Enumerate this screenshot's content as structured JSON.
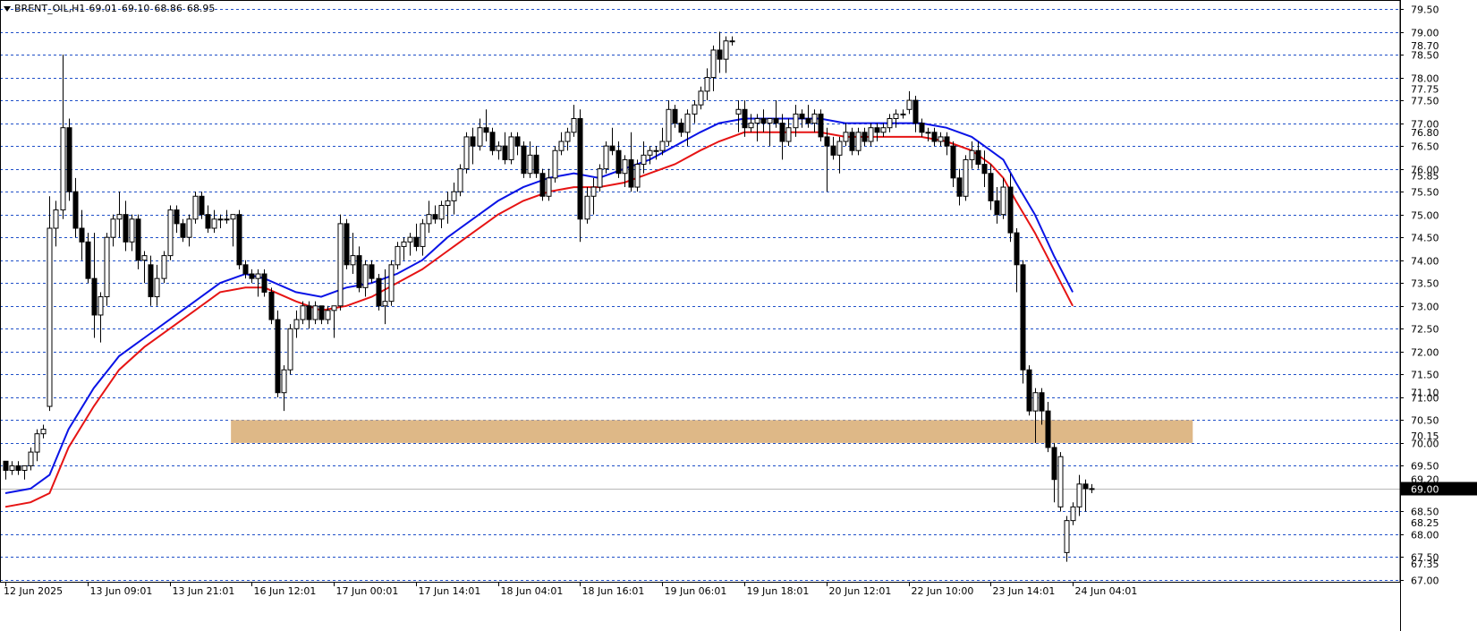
{
  "header": {
    "symbol": "BRENT_OIL,H1",
    "open": "69.01",
    "high": "69.10",
    "low": "68.86",
    "close": "68.95"
  },
  "colors": {
    "background": "#ffffff",
    "grid": "#1f4fc8",
    "bull_body": "#ffffff",
    "bear_body": "#000000",
    "candle_outline": "#000000",
    "ma_fast": "#0a14e6",
    "ma_slow": "#e61414",
    "support_zone": "#deb887",
    "current_price_label_bg": "#000000"
  },
  "chart_data": {
    "type": "candlestick",
    "symbol": "BRENT_OIL",
    "timeframe": "H1",
    "ylim": [
      67.0,
      79.5
    ],
    "y_ticks": [
      79.5,
      79.0,
      78.5,
      78.0,
      77.5,
      77.0,
      76.5,
      76.0,
      75.5,
      75.0,
      74.5,
      74.0,
      73.5,
      73.0,
      72.5,
      72.0,
      71.5,
      71.0,
      70.5,
      70.0,
      69.5,
      69.0,
      68.5,
      68.0,
      67.5,
      67.0
    ],
    "y_tick_labels": [
      "79.50",
      "79.00",
      "78.50",
      "78.00",
      "77.50",
      "77.00",
      "76.50",
      "76.00",
      "75.50",
      "75.00",
      "74.50",
      "74.00",
      "73.50",
      "73.00",
      "72.50",
      "72.00",
      "71.50",
      "71.00",
      "70.50",
      "70.00",
      "69.50",
      "69.00",
      "68.50",
      "68.00",
      "67.50",
      "67.00"
    ],
    "extra_price_labels": [
      {
        "value": 78.7,
        "label": "78.70"
      },
      {
        "value": 77.75,
        "label": "77.75"
      },
      {
        "value": 76.8,
        "label": "76.80"
      },
      {
        "value": 75.85,
        "label": "75.85"
      },
      {
        "value": 71.1,
        "label": "71.10"
      },
      {
        "value": 70.15,
        "label": "70.15"
      },
      {
        "value": 69.2,
        "label": "69.20"
      },
      {
        "value": 68.25,
        "label": "68.25"
      },
      {
        "value": 67.35,
        "label": "67.35"
      }
    ],
    "current_price": {
      "value": 69.0,
      "label": "69.00"
    },
    "x_tick_labels": [
      "12 Jun 2025",
      "13 Jun 09:01",
      "13 Jun 21:01",
      "16 Jun 12:01",
      "17 Jun 00:01",
      "17 Jun 14:01",
      "18 Jun 04:01",
      "18 Jun 16:01",
      "19 Jun 06:01",
      "19 Jun 18:01",
      "20 Jun 12:01",
      "22 Jun 10:00",
      "23 Jun 14:01",
      "24 Jun 04:01"
    ],
    "x_tick_positions": [
      0,
      13,
      26,
      39,
      52,
      65,
      78,
      91,
      104,
      117,
      130,
      143,
      156,
      169
    ],
    "support_zone": {
      "from": 70.0,
      "to": 70.5,
      "start_index": 36,
      "end_index": 188
    },
    "candles": [
      [
        69.6,
        69.6,
        69.2,
        69.4
      ],
      [
        69.4,
        69.6,
        69.3,
        69.5
      ],
      [
        69.5,
        69.6,
        69.3,
        69.4
      ],
      [
        69.4,
        69.5,
        69.2,
        69.5
      ],
      [
        69.5,
        69.9,
        69.4,
        69.8
      ],
      [
        69.8,
        70.3,
        69.6,
        70.2
      ],
      [
        70.2,
        70.4,
        70.1,
        70.3
      ],
      [
        70.8,
        75.4,
        70.7,
        74.7
      ],
      [
        74.7,
        75.3,
        74.3,
        75.1
      ],
      [
        75.1,
        78.5,
        74.9,
        76.9
      ],
      [
        76.9,
        77.1,
        75.3,
        75.5
      ],
      [
        75.5,
        75.8,
        74.5,
        74.7
      ],
      [
        74.7,
        75.1,
        74.0,
        74.4
      ],
      [
        74.4,
        74.6,
        73.5,
        73.6
      ],
      [
        73.6,
        74.6,
        72.3,
        72.8
      ],
      [
        72.8,
        73.3,
        72.2,
        73.2
      ],
      [
        73.2,
        74.6,
        73.0,
        74.5
      ],
      [
        74.5,
        75.0,
        74.3,
        74.9
      ],
      [
        74.9,
        75.5,
        74.5,
        75.0
      ],
      [
        75.0,
        75.3,
        74.2,
        74.4
      ],
      [
        74.4,
        75.0,
        74.2,
        74.9
      ],
      [
        74.9,
        75.0,
        73.8,
        74.0
      ],
      [
        74.0,
        74.2,
        73.5,
        74.1
      ],
      [
        73.9,
        74.1,
        73.0,
        73.2
      ],
      [
        73.2,
        73.9,
        73.0,
        73.6
      ],
      [
        73.6,
        74.2,
        73.5,
        74.1
      ],
      [
        74.1,
        75.2,
        74.0,
        75.1
      ],
      [
        75.1,
        75.2,
        74.6,
        74.8
      ],
      [
        74.8,
        74.9,
        74.4,
        74.5
      ],
      [
        74.5,
        75.0,
        74.3,
        74.9
      ],
      [
        74.9,
        75.5,
        74.8,
        75.4
      ],
      [
        75.4,
        75.5,
        74.9,
        75.0
      ],
      [
        75.0,
        75.2,
        74.6,
        74.7
      ],
      [
        74.7,
        75.1,
        74.6,
        74.9
      ],
      [
        74.9,
        75.0,
        74.7,
        74.9
      ],
      [
        74.9,
        75.1,
        74.8,
        74.9
      ],
      [
        74.9,
        75.0,
        74.3,
        75.0
      ],
      [
        75.0,
        75.1,
        73.8,
        73.9
      ],
      [
        73.9,
        74.0,
        73.6,
        73.7
      ],
      [
        73.7,
        73.8,
        73.5,
        73.6
      ],
      [
        73.6,
        73.8,
        73.2,
        73.7
      ],
      [
        73.7,
        73.8,
        73.2,
        73.3
      ],
      [
        73.3,
        73.4,
        72.6,
        72.7
      ],
      [
        72.7,
        72.9,
        71.0,
        71.1
      ],
      [
        71.1,
        71.7,
        70.7,
        71.6
      ],
      [
        71.6,
        72.6,
        71.5,
        72.5
      ],
      [
        72.5,
        72.9,
        72.3,
        72.7
      ],
      [
        72.7,
        73.1,
        72.6,
        73.0
      ],
      [
        73.0,
        73.1,
        72.5,
        72.7
      ],
      [
        72.7,
        73.1,
        72.6,
        73.0
      ],
      [
        73.0,
        73.0,
        72.6,
        72.7
      ],
      [
        72.7,
        73.0,
        72.6,
        72.9
      ],
      [
        72.9,
        73.0,
        72.3,
        73.0
      ],
      [
        73.0,
        75.0,
        72.9,
        74.8
      ],
      [
        74.8,
        74.9,
        73.8,
        73.9
      ],
      [
        73.9,
        74.6,
        73.7,
        74.1
      ],
      [
        74.1,
        74.3,
        73.3,
        73.4
      ],
      [
        73.4,
        74.0,
        73.2,
        73.9
      ],
      [
        73.9,
        74.0,
        73.5,
        73.6
      ],
      [
        73.6,
        73.7,
        72.9,
        73.0
      ],
      [
        73.0,
        73.8,
        72.6,
        73.1
      ],
      [
        73.1,
        74.0,
        73.0,
        73.9
      ],
      [
        73.9,
        74.4,
        73.8,
        74.3
      ],
      [
        74.3,
        74.5,
        74.0,
        74.4
      ],
      [
        74.4,
        74.6,
        74.1,
        74.5
      ],
      [
        74.5,
        74.8,
        74.2,
        74.3
      ],
      [
        74.3,
        74.9,
        74.1,
        74.8
      ],
      [
        74.8,
        75.3,
        74.6,
        75.0
      ],
      [
        75.0,
        75.2,
        74.8,
        74.9
      ],
      [
        74.9,
        75.3,
        74.7,
        75.2
      ],
      [
        75.2,
        75.5,
        74.8,
        75.3
      ],
      [
        75.3,
        75.7,
        75.0,
        75.5
      ],
      [
        75.5,
        76.1,
        75.4,
        76.0
      ],
      [
        76.0,
        76.8,
        75.9,
        76.7
      ],
      [
        76.7,
        76.9,
        76.1,
        76.5
      ],
      [
        76.5,
        77.1,
        76.4,
        76.9
      ],
      [
        76.9,
        77.3,
        76.6,
        76.8
      ],
      [
        76.8,
        76.9,
        76.3,
        76.4
      ],
      [
        76.4,
        76.6,
        76.2,
        76.5
      ],
      [
        76.5,
        76.8,
        76.1,
        76.2
      ],
      [
        76.2,
        76.8,
        76.1,
        76.7
      ],
      [
        76.7,
        76.8,
        76.3,
        76.5
      ],
      [
        76.5,
        76.6,
        75.8,
        75.9
      ],
      [
        75.9,
        76.6,
        75.8,
        76.3
      ],
      [
        76.3,
        76.5,
        75.8,
        75.9
      ],
      [
        75.9,
        76.0,
        75.3,
        75.4
      ],
      [
        75.4,
        76.0,
        75.3,
        75.8
      ],
      [
        75.8,
        76.5,
        75.7,
        76.4
      ],
      [
        76.4,
        76.8,
        76.3,
        76.6
      ],
      [
        76.6,
        76.9,
        76.4,
        76.8
      ],
      [
        76.8,
        77.4,
        76.7,
        77.1
      ],
      [
        77.1,
        77.3,
        74.4,
        74.9
      ],
      [
        74.9,
        75.6,
        74.8,
        75.4
      ],
      [
        75.4,
        75.8,
        75.0,
        75.6
      ],
      [
        75.6,
        76.1,
        75.5,
        76.0
      ],
      [
        76.0,
        76.6,
        75.9,
        76.5
      ],
      [
        76.5,
        76.9,
        76.3,
        76.4
      ],
      [
        76.4,
        76.6,
        75.8,
        75.9
      ],
      [
        75.9,
        76.3,
        75.6,
        76.2
      ],
      [
        76.2,
        76.8,
        75.5,
        75.6
      ],
      [
        75.6,
        76.2,
        75.5,
        76.1
      ],
      [
        76.1,
        76.6,
        75.9,
        76.3
      ],
      [
        76.3,
        76.5,
        76.1,
        76.4
      ],
      [
        76.4,
        76.5,
        76.2,
        76.4
      ],
      [
        76.4,
        76.9,
        76.3,
        76.6
      ],
      [
        76.6,
        77.5,
        76.5,
        77.3
      ],
      [
        77.3,
        77.4,
        76.9,
        77.0
      ],
      [
        77.0,
        77.1,
        76.7,
        76.8
      ],
      [
        76.8,
        77.3,
        76.5,
        77.2
      ],
      [
        77.2,
        77.5,
        77.0,
        77.4
      ],
      [
        77.4,
        77.8,
        77.3,
        77.7
      ],
      [
        77.7,
        78.2,
        77.5,
        78.0
      ],
      [
        78.0,
        78.7,
        77.7,
        78.6
      ],
      [
        78.6,
        79.0,
        78.1,
        78.4
      ],
      [
        78.4,
        78.9,
        78.1,
        78.8
      ],
      [
        78.8,
        78.9,
        78.7,
        78.8
      ],
      [
        77.2,
        77.5,
        76.8,
        77.3
      ],
      [
        77.3,
        77.5,
        76.7,
        76.9
      ],
      [
        76.9,
        77.2,
        76.8,
        77.0
      ],
      [
        77.0,
        77.2,
        76.6,
        77.1
      ],
      [
        77.1,
        77.3,
        76.8,
        77.0
      ],
      [
        77.0,
        77.1,
        76.5,
        77.1
      ],
      [
        77.1,
        77.5,
        76.9,
        77.0
      ],
      [
        77.0,
        77.2,
        76.2,
        76.6
      ],
      [
        76.6,
        77.1,
        76.5,
        76.9
      ],
      [
        76.9,
        77.4,
        76.7,
        77.2
      ],
      [
        77.2,
        77.3,
        76.9,
        77.1
      ],
      [
        77.1,
        77.4,
        76.9,
        77.0
      ],
      [
        77.0,
        77.3,
        76.8,
        77.2
      ],
      [
        77.2,
        77.3,
        76.6,
        76.7
      ],
      [
        76.7,
        76.9,
        75.5,
        76.5
      ],
      [
        76.5,
        76.7,
        76.2,
        76.3
      ],
      [
        76.3,
        76.7,
        75.9,
        76.6
      ],
      [
        76.6,
        77.0,
        76.5,
        76.8
      ],
      [
        76.8,
        76.9,
        76.3,
        76.4
      ],
      [
        76.4,
        76.9,
        76.3,
        76.8
      ],
      [
        76.8,
        76.9,
        76.5,
        76.6
      ],
      [
        76.6,
        77.0,
        76.5,
        76.9
      ],
      [
        76.9,
        77.0,
        76.6,
        76.8
      ],
      [
        76.8,
        77.0,
        76.7,
        76.9
      ],
      [
        76.9,
        77.2,
        76.8,
        77.1
      ],
      [
        77.1,
        77.3,
        76.9,
        77.2
      ],
      [
        77.2,
        77.3,
        77.1,
        77.2
      ],
      [
        77.3,
        77.7,
        77.2,
        77.5
      ],
      [
        77.5,
        77.6,
        76.8,
        77.0
      ],
      [
        77.0,
        77.1,
        76.7,
        76.8
      ],
      [
        76.8,
        76.9,
        76.6,
        76.8
      ],
      [
        76.8,
        76.9,
        76.5,
        76.6
      ],
      [
        76.6,
        76.8,
        76.5,
        76.7
      ],
      [
        76.7,
        76.8,
        76.3,
        76.5
      ],
      [
        76.5,
        76.6,
        75.6,
        75.8
      ],
      [
        75.8,
        76.0,
        75.2,
        75.4
      ],
      [
        75.4,
        76.3,
        75.3,
        76.2
      ],
      [
        76.2,
        76.6,
        76.0,
        76.4
      ],
      [
        76.4,
        76.6,
        76.0,
        76.1
      ],
      [
        76.1,
        76.4,
        75.6,
        75.9
      ],
      [
        75.9,
        76.1,
        75.1,
        75.3
      ],
      [
        75.3,
        75.6,
        74.8,
        75.0
      ],
      [
        75.0,
        75.8,
        74.9,
        75.6
      ],
      [
        75.6,
        75.9,
        74.4,
        74.6
      ],
      [
        74.6,
        74.7,
        73.3,
        73.9
      ],
      [
        73.9,
        74.0,
        71.3,
        71.6
      ],
      [
        71.6,
        71.7,
        70.6,
        70.7
      ],
      [
        70.7,
        71.2,
        70.0,
        71.1
      ],
      [
        71.1,
        71.2,
        70.4,
        70.7
      ],
      [
        70.7,
        70.9,
        69.8,
        69.9
      ],
      [
        69.9,
        70.0,
        68.7,
        69.2
      ],
      [
        68.6,
        69.8,
        68.5,
        69.7
      ],
      [
        67.6,
        68.4,
        67.4,
        68.3
      ],
      [
        68.3,
        68.7,
        68.2,
        68.6
      ],
      [
        68.6,
        69.3,
        68.4,
        69.1
      ],
      [
        69.1,
        69.2,
        68.5,
        69.0
      ],
      [
        69.0,
        69.1,
        68.9,
        69.0
      ]
    ],
    "ma_fast": [
      [
        0,
        68.9
      ],
      [
        4,
        69.0
      ],
      [
        7,
        69.3
      ],
      [
        10,
        70.3
      ],
      [
        14,
        71.2
      ],
      [
        18,
        71.9
      ],
      [
        22,
        72.3
      ],
      [
        26,
        72.7
      ],
      [
        30,
        73.1
      ],
      [
        34,
        73.5
      ],
      [
        38,
        73.7
      ],
      [
        41,
        73.6
      ],
      [
        46,
        73.3
      ],
      [
        50,
        73.2
      ],
      [
        54,
        73.4
      ],
      [
        58,
        73.5
      ],
      [
        62,
        73.7
      ],
      [
        66,
        74.0
      ],
      [
        70,
        74.5
      ],
      [
        74,
        74.9
      ],
      [
        78,
        75.3
      ],
      [
        82,
        75.6
      ],
      [
        86,
        75.8
      ],
      [
        90,
        75.9
      ],
      [
        94,
        75.8
      ],
      [
        98,
        76.0
      ],
      [
        102,
        76.2
      ],
      [
        106,
        76.5
      ],
      [
        110,
        76.8
      ],
      [
        113,
        77.0
      ],
      [
        117,
        77.1
      ],
      [
        121,
        77.1
      ],
      [
        125,
        77.1
      ],
      [
        129,
        77.1
      ],
      [
        133,
        77.0
      ],
      [
        137,
        77.0
      ],
      [
        141,
        77.0
      ],
      [
        145,
        77.0
      ],
      [
        149,
        76.9
      ],
      [
        153,
        76.7
      ],
      [
        156,
        76.4
      ],
      [
        158,
        76.2
      ],
      [
        160,
        75.7
      ],
      [
        163,
        75.0
      ],
      [
        166,
        74.1
      ],
      [
        169,
        73.3
      ]
    ],
    "ma_slow": [
      [
        0,
        68.6
      ],
      [
        4,
        68.7
      ],
      [
        7,
        68.9
      ],
      [
        10,
        69.9
      ],
      [
        14,
        70.8
      ],
      [
        18,
        71.6
      ],
      [
        22,
        72.1
      ],
      [
        26,
        72.5
      ],
      [
        30,
        72.9
      ],
      [
        34,
        73.3
      ],
      [
        38,
        73.4
      ],
      [
        41,
        73.4
      ],
      [
        46,
        73.1
      ],
      [
        50,
        72.9
      ],
      [
        54,
        73.0
      ],
      [
        58,
        73.2
      ],
      [
        62,
        73.5
      ],
      [
        66,
        73.8
      ],
      [
        70,
        74.2
      ],
      [
        74,
        74.6
      ],
      [
        78,
        75.0
      ],
      [
        82,
        75.3
      ],
      [
        86,
        75.5
      ],
      [
        90,
        75.6
      ],
      [
        94,
        75.6
      ],
      [
        98,
        75.7
      ],
      [
        102,
        75.9
      ],
      [
        106,
        76.1
      ],
      [
        110,
        76.4
      ],
      [
        113,
        76.6
      ],
      [
        117,
        76.8
      ],
      [
        121,
        76.8
      ],
      [
        125,
        76.8
      ],
      [
        129,
        76.8
      ],
      [
        133,
        76.7
      ],
      [
        137,
        76.7
      ],
      [
        141,
        76.7
      ],
      [
        145,
        76.7
      ],
      [
        149,
        76.6
      ],
      [
        153,
        76.4
      ],
      [
        156,
        76.1
      ],
      [
        158,
        75.8
      ],
      [
        160,
        75.3
      ],
      [
        163,
        74.6
      ],
      [
        166,
        73.8
      ],
      [
        169,
        73.0
      ]
    ]
  }
}
